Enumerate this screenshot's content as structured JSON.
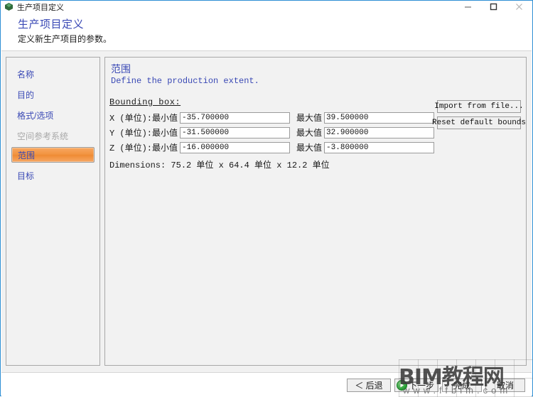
{
  "titlebar": {
    "title": "生产项目定义",
    "icon": "cube-icon",
    "minimize_label": "minimize-icon",
    "maximize_label": "maximize-icon",
    "close_label": "close-icon"
  },
  "header": {
    "title": "生产项目定义",
    "subtitle": "定义新生产项目的参数。"
  },
  "sidebar": {
    "items": [
      {
        "label": "名称",
        "state": "normal"
      },
      {
        "label": "目的",
        "state": "normal"
      },
      {
        "label": "格式/选项",
        "state": "normal"
      },
      {
        "label": "空间参考系统",
        "state": "disabled"
      },
      {
        "label": "范围",
        "state": "selected"
      },
      {
        "label": "目标",
        "state": "normal"
      }
    ]
  },
  "content": {
    "title": "范围",
    "subtitle": "Define the production extent.",
    "bounding_box_label": "Bounding box:",
    "min_label": "最小值",
    "max_label": "最大值",
    "rows": [
      {
        "axis": "X (单位):",
        "min": "-35.700000",
        "max": "39.500000"
      },
      {
        "axis": "Y (单位):",
        "min": "-31.500000",
        "max": "32.900000"
      },
      {
        "axis": "Z (单位):",
        "min": "-16.000000",
        "max": "-3.800000"
      }
    ],
    "dimensions": "Dimensions: 75.2 单位 x 64.4 单位 x 12.2 单位",
    "import_button": "Import from file...",
    "reset_button": "Reset default bounds"
  },
  "footer": {
    "back": "＜ 后退",
    "next": "下一步",
    "finish": "完成",
    "cancel": "取消"
  },
  "watermark": {
    "main": "BIM教程网",
    "sub": "www.ffbim.com"
  },
  "colors": {
    "window_border": "#2e8fd4",
    "link_blue": "#3a49b5",
    "selected_orange": "#f2933f",
    "panel_bg": "#f1f1f1",
    "next_green": "#1f9b2e"
  }
}
